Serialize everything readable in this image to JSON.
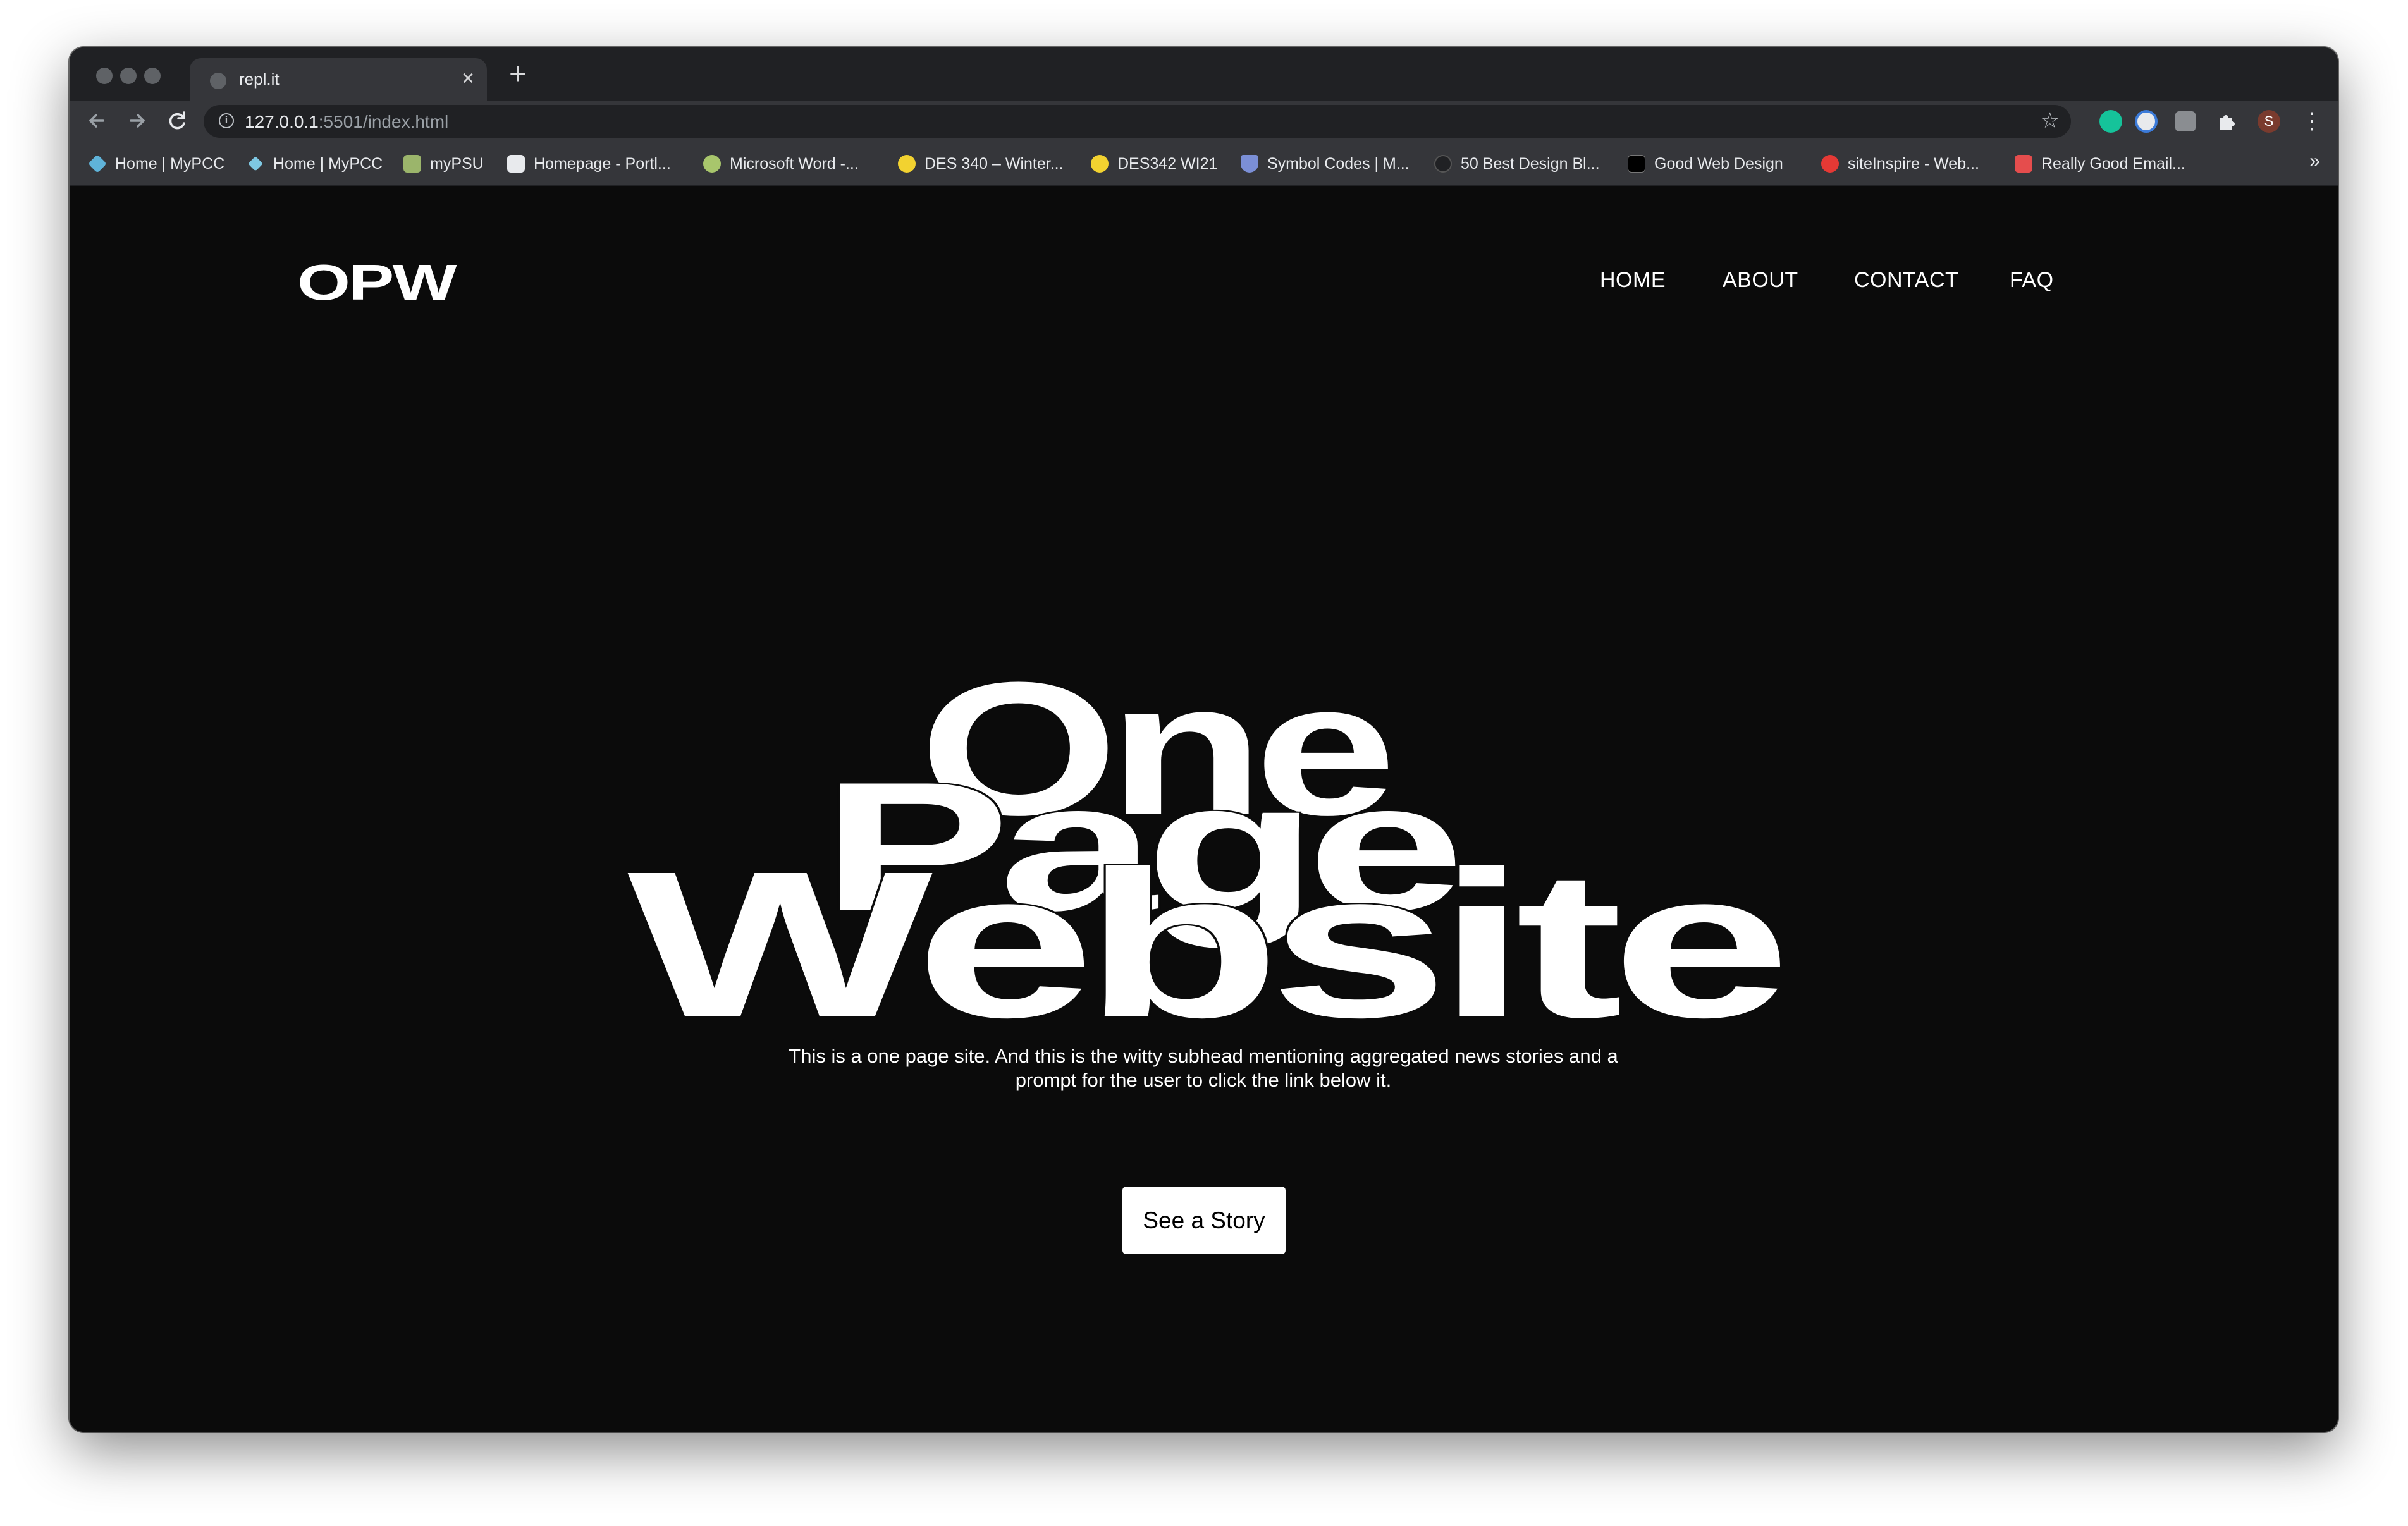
{
  "browser": {
    "tab_title": "repl.it",
    "url_host": "127.0.0.1",
    "url_rest": ":5501/index.html",
    "profile_initial": "S",
    "bookmarks": [
      {
        "label": "Home | MyPCC",
        "icon": "mypcc-icon",
        "color": "#5fb3d9"
      },
      {
        "label": "Home | MyPCC",
        "icon": "mypcc-icon",
        "color": "#7ec8e3"
      },
      {
        "label": "myPSU",
        "icon": "mypsu-icon",
        "color": "#9bb56b"
      },
      {
        "label": "Homepage - Portl...",
        "icon": "portland-icon",
        "color": "#e8eaed"
      },
      {
        "label": "Microsoft Word -...",
        "icon": "puzzle-icon",
        "color": "#a8c66c"
      },
      {
        "label": "DES 340 – Winter...",
        "icon": "des-icon",
        "color": "#f2d230"
      },
      {
        "label": "DES342 WI21",
        "icon": "des-icon",
        "color": "#f2d230"
      },
      {
        "label": "Symbol Codes | M...",
        "icon": "shield-icon",
        "color": "#7b8fd6"
      },
      {
        "label": "50 Best Design Bl...",
        "icon": "dot-icon",
        "color": "#202124"
      },
      {
        "label": "Good Web Design",
        "icon": "gd-icon",
        "color": "#000000"
      },
      {
        "label": "siteInspire - Web...",
        "icon": "siteinspire-icon",
        "color": "#e53935"
      },
      {
        "label": "Really Good Email...",
        "icon": "email-icon",
        "color": "#e54d4d"
      }
    ],
    "more_label": "»"
  },
  "site": {
    "logo": "OPW",
    "nav": [
      "HOME",
      "ABOUT",
      "CONTACT",
      "FAQ"
    ],
    "hero": {
      "line1": "One",
      "line2": "Page",
      "line3": "Website"
    },
    "subhead": "This is a one page site. And this is the witty subhead mentioning aggregated news stories and a prompt for the user to click the link below it.",
    "cta": "See a Story"
  }
}
